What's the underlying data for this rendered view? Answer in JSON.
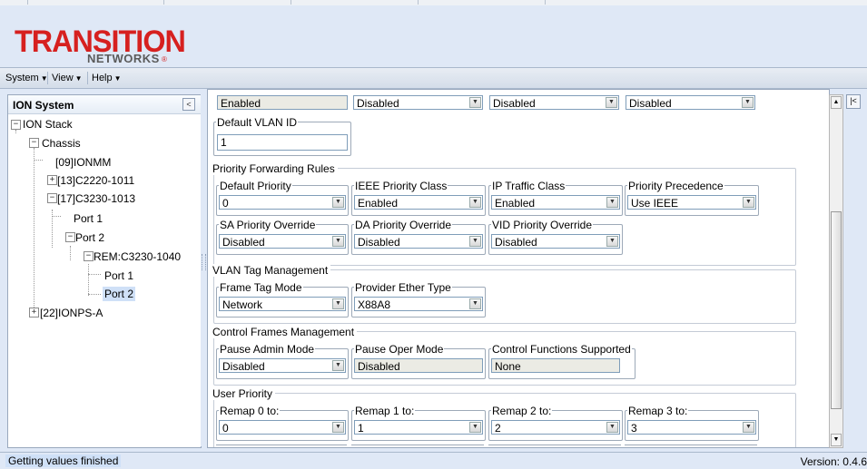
{
  "app": {
    "logo_line1": "TRANSITION",
    "logo_line2": "NETWORKS",
    "brand_color": "#d6201f"
  },
  "menu": [
    {
      "label": "System"
    },
    {
      "label": "View"
    },
    {
      "label": "Help"
    }
  ],
  "tree": {
    "title": "ION System",
    "nodes": {
      "ion_stack": "ION Stack",
      "chassis": "Chassis",
      "n09": "[09]IONMM",
      "n13": "[13]C2220-1011",
      "n17": "[17]C3230-1013",
      "port1": "Port 1",
      "port2": "Port 2",
      "rem": "REM:C3230-1040",
      "rem_port1": "Port 1",
      "rem_port2": "Port 2",
      "n22": "[22]IONPS-A"
    }
  },
  "form": {
    "top_row": [
      "Enabled",
      "Disabled",
      "Disabled",
      "Disabled"
    ],
    "default_vlan": {
      "label": "Default VLAN ID",
      "value": "1"
    },
    "priority_forwarding": {
      "title": "Priority Forwarding Rules",
      "default_priority": {
        "label": "Default Priority",
        "value": "0"
      },
      "ieee_priority_class": {
        "label": "IEEE Priority Class",
        "value": "Enabled"
      },
      "ip_traffic_class": {
        "label": "IP Traffic Class",
        "value": "Enabled"
      },
      "priority_precedence": {
        "label": "Priority Precedence",
        "value": "Use IEEE"
      },
      "sa_priority_override": {
        "label": "SA Priority Override",
        "value": "Disabled"
      },
      "da_priority_override": {
        "label": "DA Priority Override",
        "value": "Disabled"
      },
      "vid_priority_override": {
        "label": "VID Priority Override",
        "value": "Disabled"
      }
    },
    "vlan_tag": {
      "title": "VLAN Tag Management",
      "frame_tag_mode": {
        "label": "Frame Tag Mode",
        "value": "Network"
      },
      "provider_ether_type": {
        "label": "Provider Ether Type",
        "value": "X88A8"
      }
    },
    "control_frames": {
      "title": "Control Frames Management",
      "pause_admin_mode": {
        "label": "Pause Admin Mode",
        "value": "Disabled"
      },
      "pause_oper_mode": {
        "label": "Pause Oper Mode",
        "value": "Disabled"
      },
      "control_functions": {
        "label": "Control Functions Supported",
        "value": "None"
      }
    },
    "user_priority": {
      "title": "User Priority",
      "remap0": {
        "label": "Remap 0 to:",
        "value": "0"
      },
      "remap1": {
        "label": "Remap 1 to:",
        "value": "1"
      },
      "remap2": {
        "label": "Remap 2 to:",
        "value": "2"
      },
      "remap3": {
        "label": "Remap 3 to:",
        "value": "3"
      }
    }
  },
  "status": {
    "text": "Getting values finished",
    "version": "Version: 0.4.6"
  }
}
